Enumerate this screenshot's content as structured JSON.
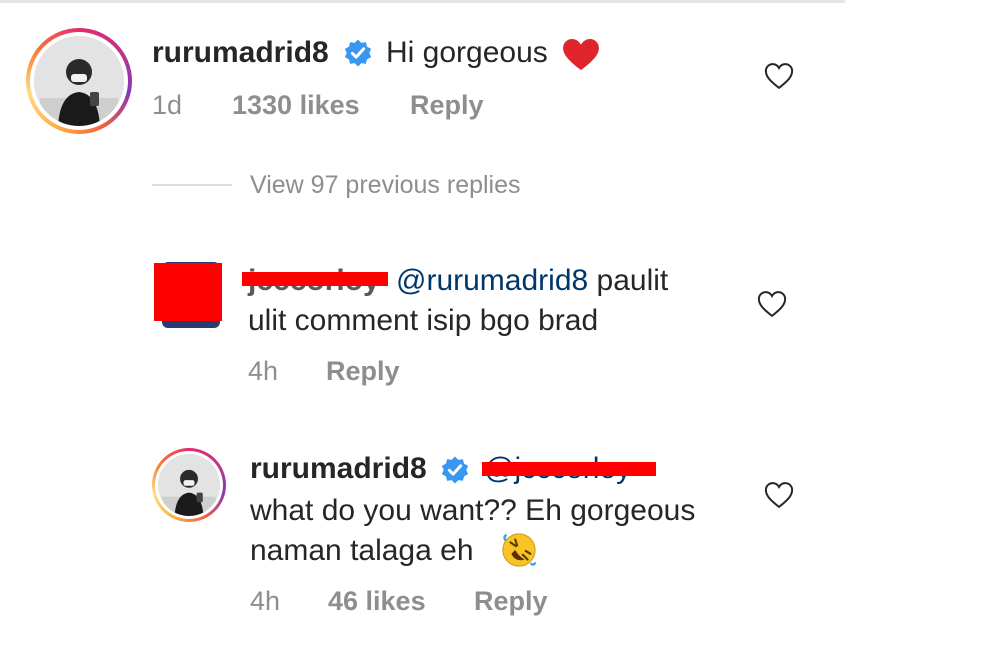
{
  "comment": {
    "username": "rurumadrid8",
    "text": "Hi gorgeous",
    "time": "1d",
    "likes": "1330 likes",
    "reply_label": "Reply"
  },
  "view_previous": "View 97 previous replies",
  "reply1": {
    "username": "jcccorloy",
    "mention": "@rurumadrid8",
    "text_line1": " paulit",
    "text_line2": "ulit comment isip bgo brad",
    "time": "4h",
    "reply_label": "Reply"
  },
  "reply2": {
    "username": "rurumadrid8",
    "mention": "@jcccorloy",
    "text_line1": "what do you want?? Eh gorgeous",
    "text_line2": "naman talaga eh",
    "time": "4h",
    "likes": "46 likes",
    "reply_label": "Reply"
  },
  "icons": {
    "verified": "verified-badge-icon",
    "like": "heart-outline-icon",
    "emoji_heart": "red-heart-emoji",
    "emoji_laugh": "rolling-on-floor-laughing-emoji"
  },
  "colors": {
    "verified_blue": "#3897f0",
    "mention": "#00376b",
    "muted": "#8e8e8e",
    "redaction": "#ff0000"
  }
}
